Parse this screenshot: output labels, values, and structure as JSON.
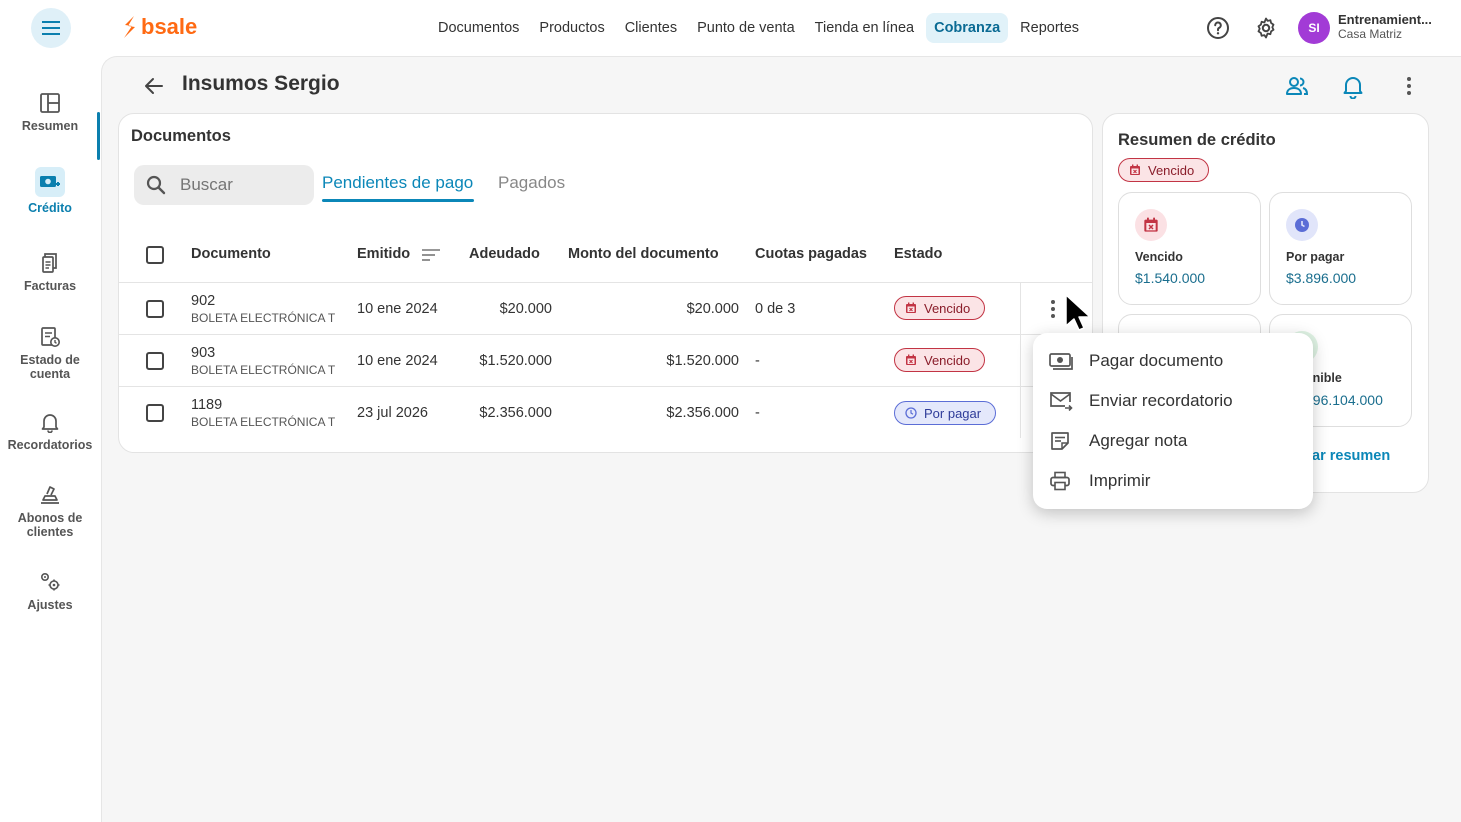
{
  "brand": {
    "name": "bsale",
    "color": "#ff6a13",
    "accent": "#0b87b8"
  },
  "nav": {
    "items": [
      "Documentos",
      "Productos",
      "Clientes",
      "Punto de venta",
      "Tienda en línea",
      "Cobranza",
      "Reportes"
    ],
    "active": "Cobranza"
  },
  "user": {
    "initials": "SI",
    "name": "Entrenamient...",
    "branch": "Casa Matriz"
  },
  "sidebar": {
    "items": [
      {
        "label": "Resumen",
        "icon": "layout-icon"
      },
      {
        "label": "Crédito",
        "icon": "money-icon",
        "active": true
      },
      {
        "label": "Facturas",
        "icon": "invoice-icon"
      },
      {
        "label": "Estado de cuenta",
        "icon": "statement-icon"
      },
      {
        "label": "Recordatorios",
        "icon": "bell-icon"
      },
      {
        "label": "Abonos de clientes",
        "icon": "payment-icon"
      },
      {
        "label": "Ajustes",
        "icon": "settings-icon"
      }
    ]
  },
  "page": {
    "title": "Insumos Sergio"
  },
  "documents": {
    "title": "Documentos",
    "search_placeholder": "Buscar",
    "tabs": [
      "Pendientes de pago",
      "Pagados"
    ],
    "columns": [
      "Documento",
      "Emitido",
      "Adeudado",
      "Monto del documento",
      "Cuotas pagadas",
      "Estado"
    ],
    "rows": [
      {
        "number": "902",
        "type": "BOLETA ELECTRÓNICA T",
        "issued": "10 ene 2024",
        "owed": "$20.000",
        "amount": "$20.000",
        "installments": "0 de 3",
        "status": "Vencido"
      },
      {
        "number": "903",
        "type": "BOLETA ELECTRÓNICA T",
        "issued": "10 ene 2024",
        "owed": "$1.520.000",
        "amount": "$1.520.000",
        "installments": "-",
        "status": "Vencido"
      },
      {
        "number": "1189",
        "type": "BOLETA ELECTRÓNICA T",
        "issued": "23 jul 2026",
        "owed": "$2.356.000",
        "amount": "$2.356.000",
        "installments": "-",
        "status": "Por pagar"
      }
    ]
  },
  "credit": {
    "title": "Resumen de crédito",
    "status_badge": "Vencido",
    "cards": [
      {
        "label": "Vencido",
        "value": "$1.540.000"
      },
      {
        "label": "Por pagar",
        "value": "$3.896.000"
      }
    ],
    "partial_label": "onible",
    "partial_value": "996.104.000",
    "partial_link": "iar resumen"
  },
  "menu": {
    "items": [
      "Pagar documento",
      "Enviar recordatorio",
      "Agregar nota",
      "Imprimir"
    ]
  }
}
